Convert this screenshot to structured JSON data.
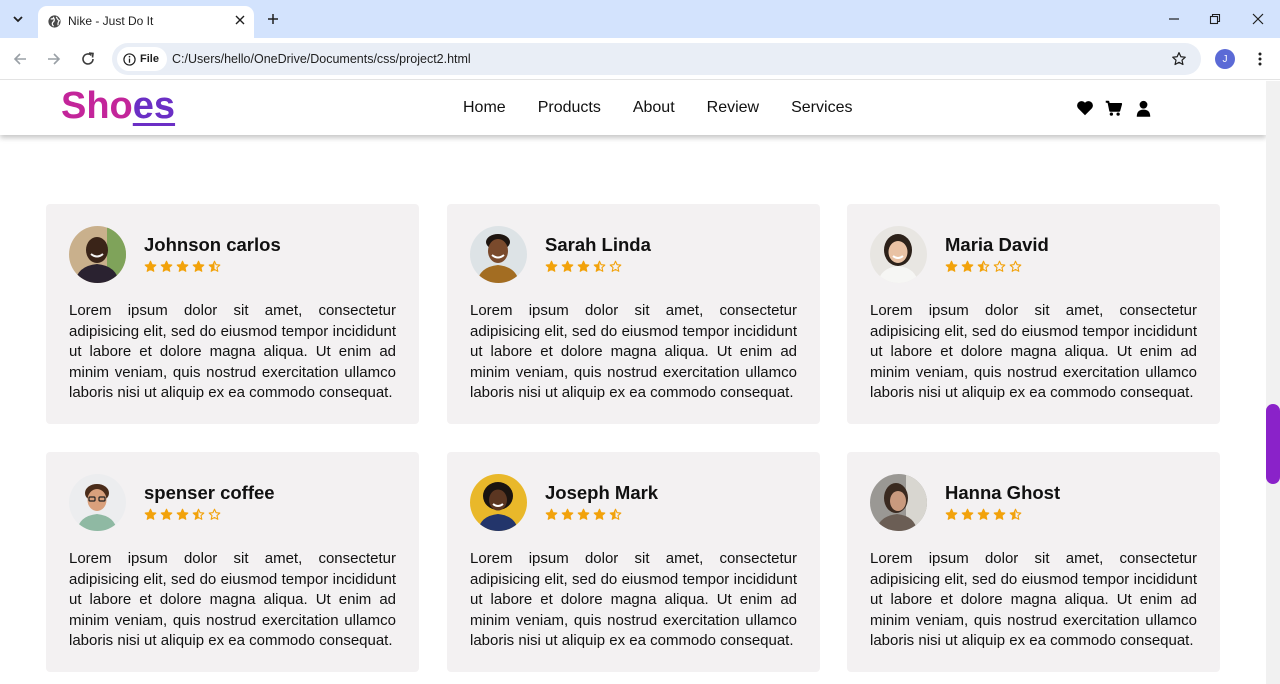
{
  "browser": {
    "tab_title": "Nike - Just Do It",
    "file_chip": "File",
    "url": "C:/Users/hello/OneDrive/Documents/css/project2.html",
    "profile_initial": "J"
  },
  "header": {
    "logo_main": "Sho",
    "logo_accent": "es",
    "nav": [
      "Home",
      "Products",
      "About",
      "Review",
      "Services"
    ],
    "icons": [
      "heart-icon",
      "cart-icon",
      "user-icon"
    ]
  },
  "colors": {
    "logo": "#c3259a",
    "logo_accent": "#6b2fc5",
    "star": "#f2a20b",
    "card_bg": "#f3f1f2",
    "scroll_thumb": "#8a22c9"
  },
  "reviews": [
    {
      "name": "Johnson carlos",
      "rating": 4.5,
      "avatar": "avatar-dark-man-smiling",
      "text": "Lorem ipsum dolor sit amet, consectetur adipisicing elit, sed do eiusmod tempor incididunt ut labore et dolore magna aliqua. Ut enim ad minim veniam, quis nostrud exercitation ullamco laboris nisi ut aliquip ex ea commodo consequat."
    },
    {
      "name": "Sarah Linda",
      "rating": 3.5,
      "avatar": "avatar-man-curly-hair",
      "text": "Lorem ipsum dolor sit amet, consectetur adipisicing elit, sed do eiusmod tempor incididunt ut labore et dolore magna aliqua. Ut enim ad minim veniam, quis nostrud exercitation ullamco laboris nisi ut aliquip ex ea commodo consequat."
    },
    {
      "name": "Maria David",
      "rating": 2.5,
      "avatar": "avatar-woman-smiling",
      "text": "Lorem ipsum dolor sit amet, consectetur adipisicing elit, sed do eiusmod tempor incididunt ut labore et dolore magna aliqua. Ut enim ad minim veniam, quis nostrud exercitation ullamco laboris nisi ut aliquip ex ea commodo consequat."
    },
    {
      "name": "spenser coffee",
      "rating": 3.5,
      "avatar": "avatar-man-glasses",
      "text": "Lorem ipsum dolor sit amet, consectetur adipisicing elit, sed do eiusmod tempor incididunt ut labore et dolore magna aliqua. Ut enim ad minim veniam, quis nostrud exercitation ullamco laboris nisi ut aliquip ex ea commodo consequat."
    },
    {
      "name": "Joseph Mark",
      "rating": 4.5,
      "avatar": "avatar-woman-yellow-bg",
      "text": "Lorem ipsum dolor sit amet, consectetur adipisicing elit, sed do eiusmod tempor incididunt ut labore et dolore magna aliqua. Ut enim ad minim veniam, quis nostrud exercitation ullamco laboris nisi ut aliquip ex ea commodo consequat."
    },
    {
      "name": "Hanna Ghost",
      "rating": 4.5,
      "avatar": "avatar-woman-window",
      "text": "Lorem ipsum dolor sit amet, consectetur adipisicing elit, sed do eiusmod tempor incididunt ut labore et dolore magna aliqua. Ut enim ad minim veniam, quis nostrud exercitation ullamco laboris nisi ut aliquip ex ea commodo consequat."
    }
  ]
}
